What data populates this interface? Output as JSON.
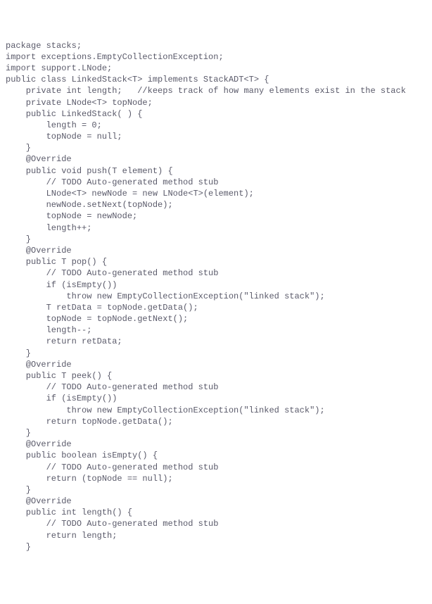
{
  "code": {
    "lines": [
      "package stacks;",
      "",
      "import exceptions.EmptyCollectionException;",
      "import support.LNode;",
      "",
      "public class LinkedStack<T> implements StackADT<T> {",
      "",
      "    private int length;   //keeps track of how many elements exist in the stack",
      "    private LNode<T> topNode;",
      "",
      "    public LinkedStack( ) {",
      "        length = 0;",
      "        topNode = null;",
      "    }",
      "",
      "    @Override",
      "    public void push(T element) {",
      "        // TODO Auto-generated method stub",
      "",
      "        LNode<T> newNode = new LNode<T>(element);",
      "        newNode.setNext(topNode);",
      "        topNode = newNode;",
      "        length++;",
      "    }",
      "",
      "    @Override",
      "    public T pop() {",
      "        // TODO Auto-generated method stub",
      "        if (isEmpty())",
      "            throw new EmptyCollectionException(\"linked stack\");",
      "",
      "        T retData = topNode.getData();",
      "        topNode = topNode.getNext();",
      "        length--;",
      "        return retData;",
      "    }",
      "",
      "    @Override",
      "    public T peek() {",
      "        // TODO Auto-generated method stub",
      "        if (isEmpty())",
      "            throw new EmptyCollectionException(\"linked stack\");",
      "",
      "        return topNode.getData();",
      "",
      "    }",
      "",
      "    @Override",
      "    public boolean isEmpty() {",
      "        // TODO Auto-generated method stub",
      "        return (topNode == null);",
      "    }",
      "",
      "    @Override",
      "    public int length() {",
      "        // TODO Auto-generated method stub",
      "        return length;",
      "    }"
    ]
  }
}
